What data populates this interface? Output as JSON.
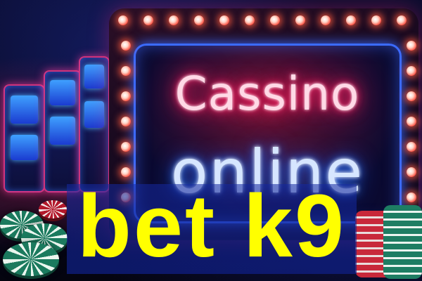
{
  "scene": {
    "neon_sign": {
      "line1": "Cassino",
      "line2": "online"
    },
    "caption": "bet k9",
    "colors": {
      "caption_text": "#ffff00",
      "caption_band": "#1a2fa0",
      "neon_pink": "#ff2d6f",
      "neon_blue": "#2f7bff",
      "bulbs": "#ff5a4a"
    }
  }
}
